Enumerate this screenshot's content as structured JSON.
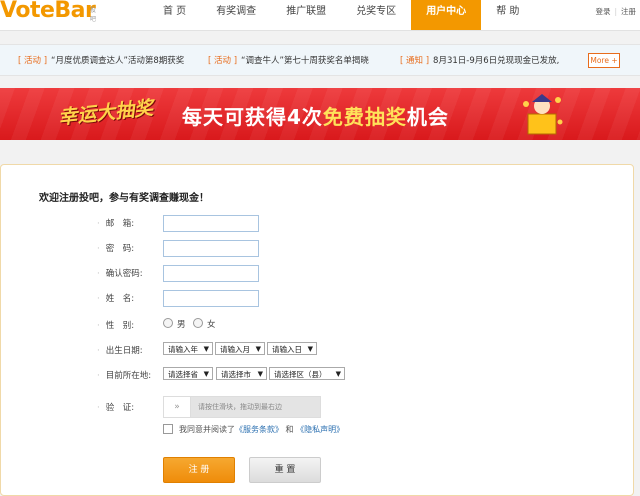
{
  "brand": {
    "logo": "VoteBar",
    "logo_sub": "投吧"
  },
  "nav": {
    "items": [
      {
        "label": "首 页"
      },
      {
        "label": "有奖调查"
      },
      {
        "label": "推广联盟"
      },
      {
        "label": "兑奖专区"
      },
      {
        "label": "用户中心"
      },
      {
        "label": "帮 助"
      }
    ],
    "active": "用户中心"
  },
  "top_links": {
    "login": "登录",
    "register": "注册"
  },
  "notices": [
    {
      "tag": "[ 活动 ]",
      "text": "“月度优质调查达人”活动第8期获奖"
    },
    {
      "tag": "[ 活动 ]",
      "text": "“调查牛人”第七十周获奖名单揭晓"
    },
    {
      "tag": "[ 通知 ]",
      "text": "8月31日-9月6日兑现现金已发放,"
    }
  ],
  "more_label": "More +",
  "banner": {
    "logo_text": "幸运大抽奖",
    "main_prefix": "每天可获得4次",
    "main_highlight": "免费抽奖",
    "main_suffix": "机会"
  },
  "form": {
    "welcome": "欢迎注册投吧，参与有奖调查赚现金！",
    "email_label": "邮　箱:",
    "password_label": "密　码:",
    "confirm_label": "确认密码:",
    "name_label": "姓　名:",
    "gender_label": "性　别:",
    "gender_male": "男",
    "gender_female": "女",
    "birth_label": "出生日期:",
    "birth_year": "请输入年",
    "birth_month": "请输入月",
    "birth_day": "请输入日",
    "location_label": "目前所在地:",
    "province": "请选择省",
    "city": "请选择市",
    "district": "请选择区（县）",
    "verify_label": "验　证:",
    "slider_handle": "»",
    "slider_hint": "请按住滑块，拖动到最右边",
    "agree_prefix": "我同意并阅读了",
    "terms_link": "《服务条款》",
    "agree_and": "和",
    "privacy_link": "《隐私声明》",
    "submit": "注 册",
    "reset": "重 置"
  },
  "colors": {
    "accent": "#f39800",
    "banner_red": "#e32b2e",
    "link": "#2a6fb0"
  }
}
